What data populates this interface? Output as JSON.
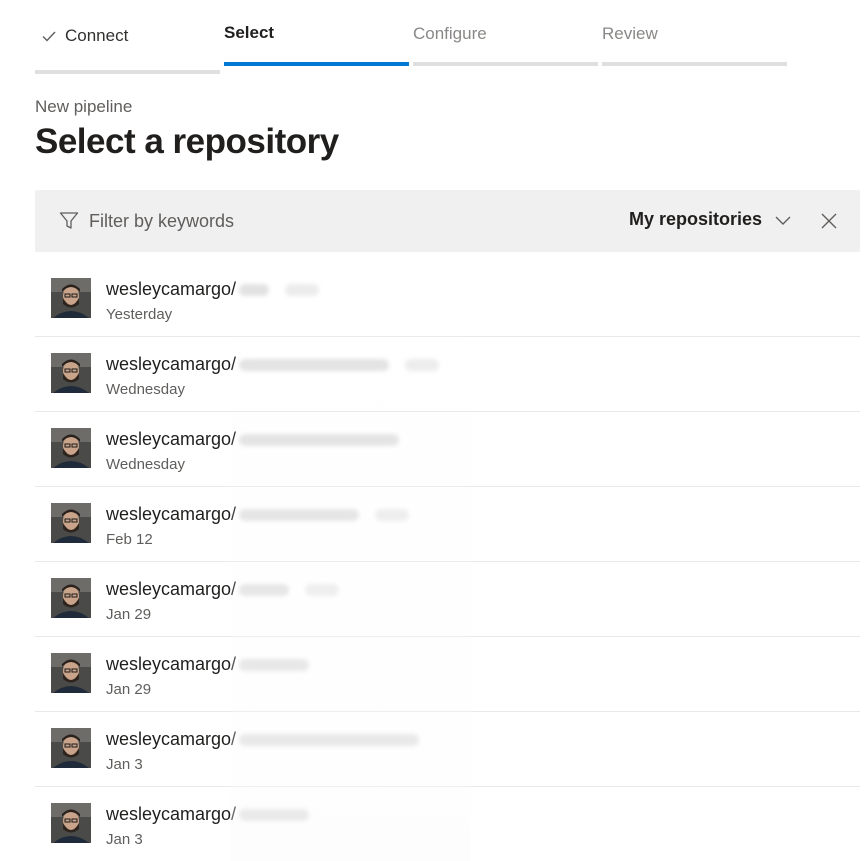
{
  "steps": [
    {
      "label": "Connect",
      "state": "done"
    },
    {
      "label": "Select",
      "state": "active"
    },
    {
      "label": "Configure",
      "state": "upcoming"
    },
    {
      "label": "Review",
      "state": "upcoming"
    }
  ],
  "header": {
    "subtitle": "New pipeline",
    "title": "Select a repository"
  },
  "filter": {
    "placeholder": "Filter by keywords",
    "scope_label": "My repositories"
  },
  "repos": [
    {
      "owner": "wesleycamargo/",
      "date": "Yesterday",
      "tag": true
    },
    {
      "owner": "wesleycamargo/",
      "date": "Wednesday",
      "tag": true
    },
    {
      "owner": "wesleycamargo/",
      "date": "Wednesday",
      "tag": false
    },
    {
      "owner": "wesleycamargo/",
      "date": "Feb 12",
      "tag": true
    },
    {
      "owner": "wesleycamargo/",
      "date": "Jan 29",
      "tag": true
    },
    {
      "owner": "wesleycamargo/",
      "date": "Jan 29",
      "tag": false
    },
    {
      "owner": "wesleycamargo/",
      "date": "Jan 3",
      "tag": false
    },
    {
      "owner": "wesleycamargo/",
      "date": "Jan 3",
      "tag": false
    }
  ],
  "colors": {
    "accent": "#0078d4",
    "filter_bg": "#f0f0f0",
    "divider": "#e9e9e9"
  }
}
